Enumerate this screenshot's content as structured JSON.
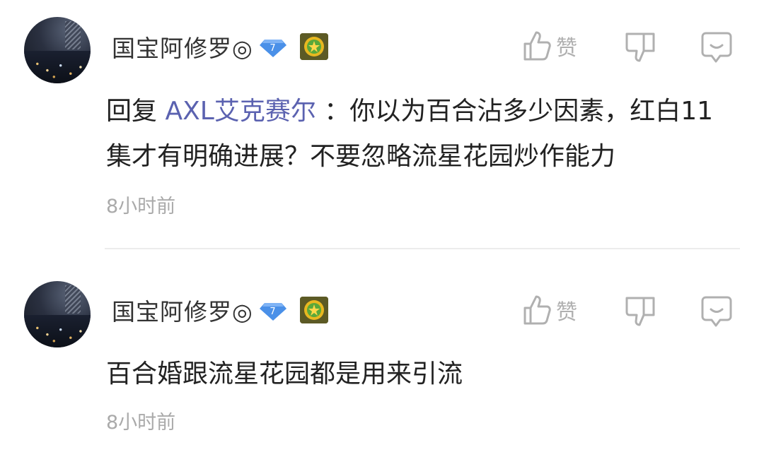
{
  "comments": [
    {
      "username": "国宝阿修罗◎",
      "vip_level": "7",
      "like_label": "赞",
      "reply_prefix": "回复",
      "reply_to": "AXL艾克赛尔",
      "text_line1": "：你以为百合沾多少因素，红白11",
      "text_line2": "集才有明确进展？不要忽略流星花园炒作能力",
      "time": "8小时前"
    },
    {
      "username": "国宝阿修罗◎",
      "vip_level": "7",
      "like_label": "赞",
      "text_line1": "百合婚跟流星花园都是用来引流",
      "time": "8小时前"
    }
  ],
  "colors": {
    "reply_link": "#5b62b0",
    "vip_badge": "#4a90e8",
    "action_gray": "#b0b0b0",
    "time_gray": "#aaaaaa"
  },
  "icons": [
    "thumbs-up-icon",
    "thumbs-down-icon",
    "comment-reply-icon",
    "vip-diamond-icon",
    "medal-badge-icon"
  ]
}
